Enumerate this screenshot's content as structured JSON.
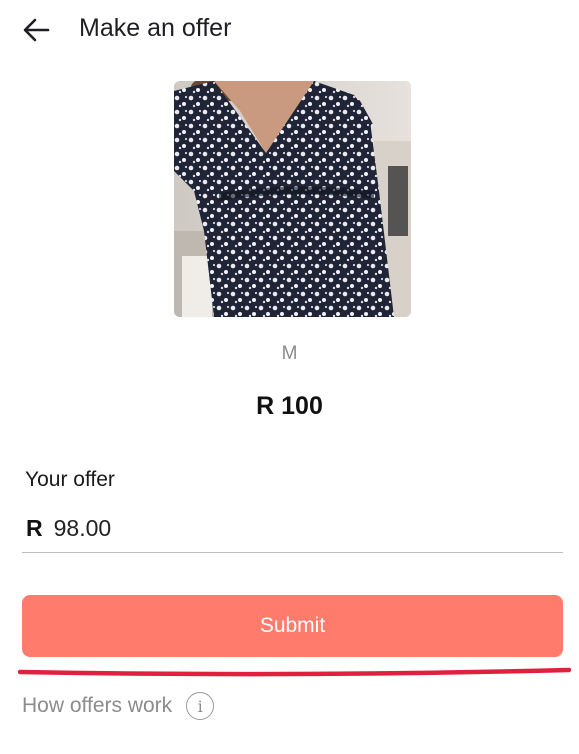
{
  "header": {
    "title": "Make an offer",
    "back_icon": "arrow-left-icon"
  },
  "product": {
    "image_alt": "Navy and white floral print wrap dress",
    "size": "M",
    "price": "R 100"
  },
  "offer": {
    "label": "Your offer",
    "currency": "R",
    "value": "98.00"
  },
  "submit": {
    "label": "Submit",
    "color": "#ff7b6b"
  },
  "footer": {
    "how_offers_work": "How offers work",
    "info_icon_glyph": "i"
  }
}
